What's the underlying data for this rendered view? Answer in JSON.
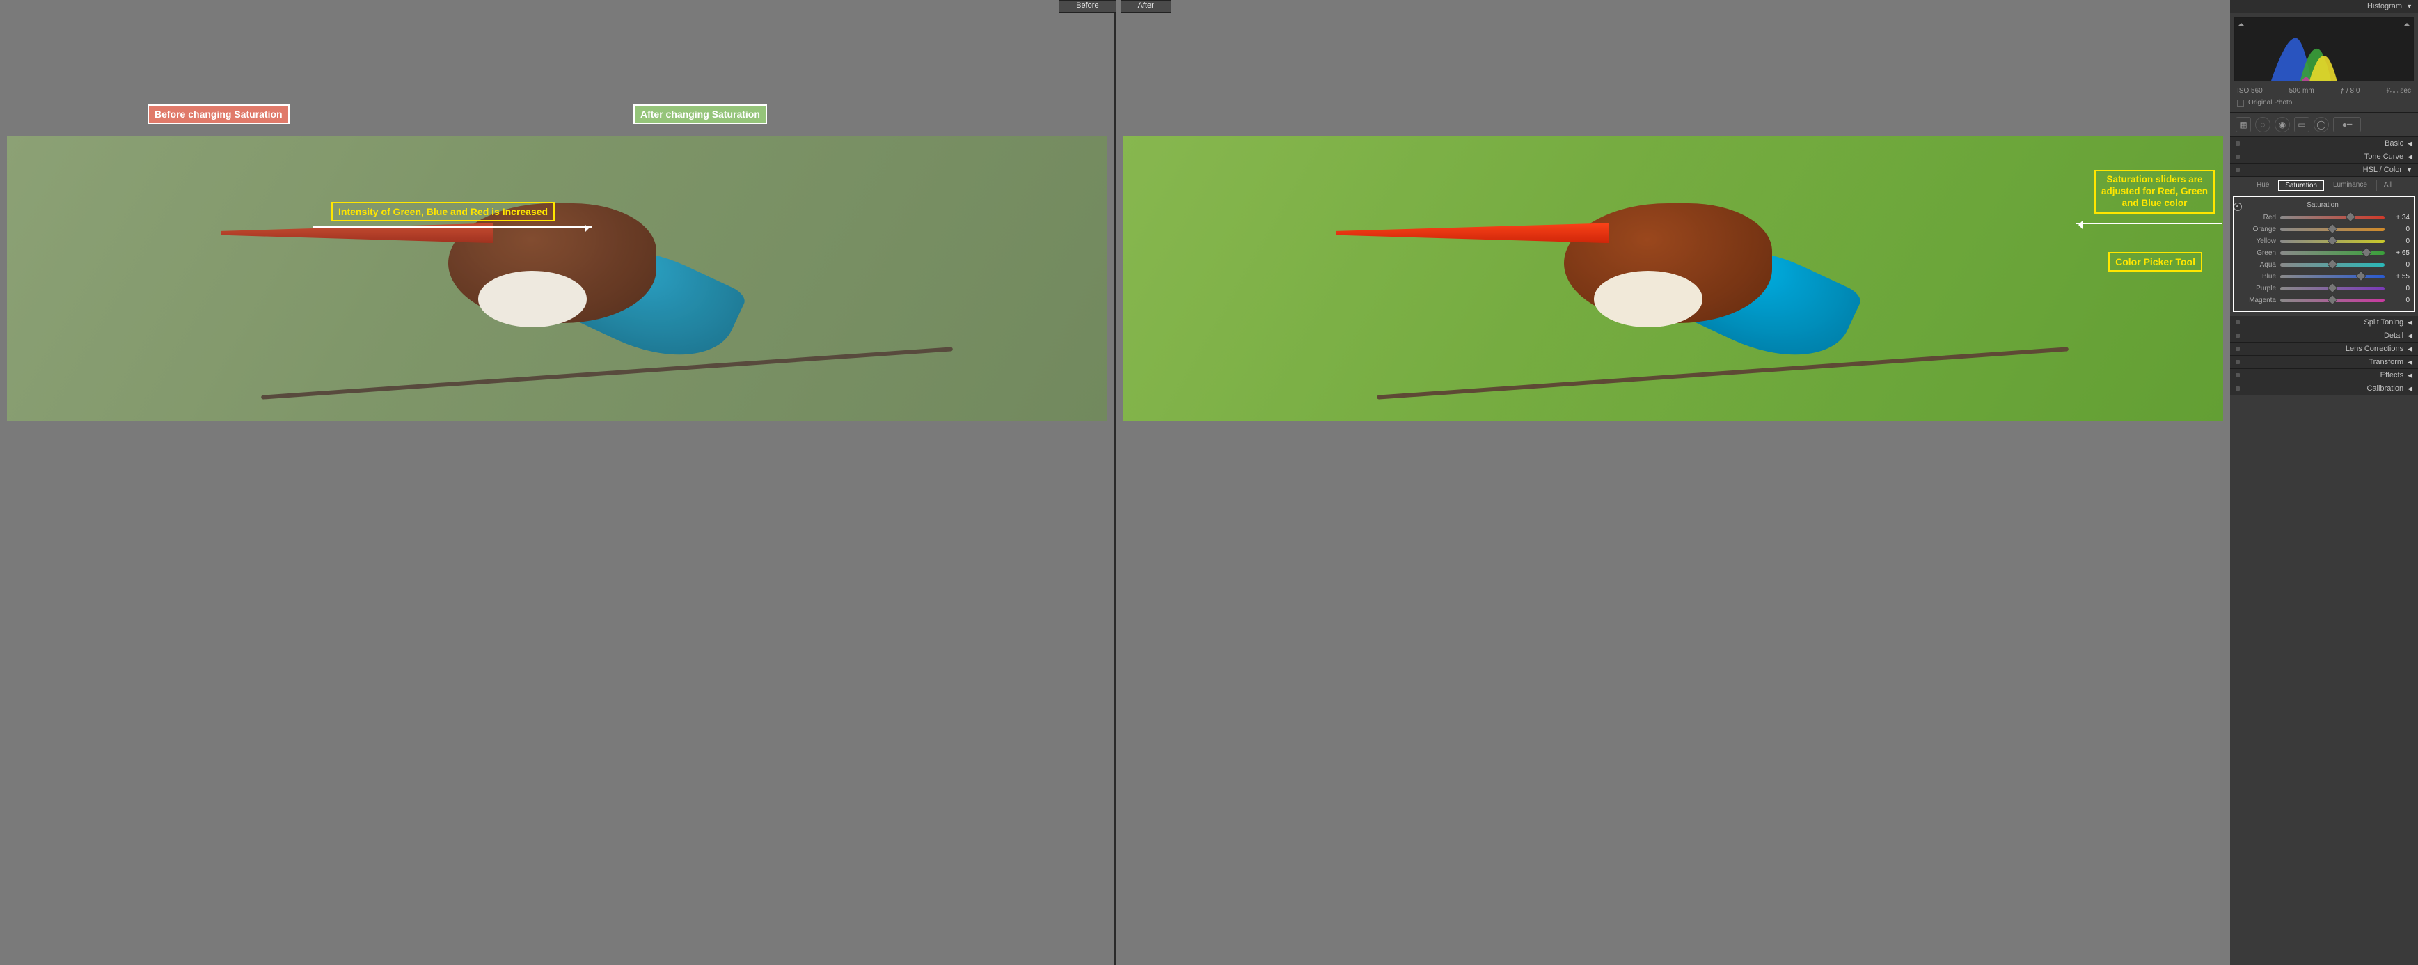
{
  "ba_labels": {
    "before": "Before",
    "after": "After"
  },
  "annotations": {
    "before_caption": "Before changing Saturation",
    "after_caption": "After changing Saturation",
    "intensity_note": "Intensity of Green, Blue and Red is Increased",
    "slider_note_l1": "Saturation sliders are",
    "slider_note_l2": "adjusted for Red, Green",
    "slider_note_l3": "and Blue color",
    "picker_note": "Color Picker Tool"
  },
  "panel": {
    "histogram": "Histogram",
    "meta": {
      "iso": "ISO 560",
      "focal": "500 mm",
      "aperture": "ƒ / 8.0",
      "shutter": "¹⁄₅₀₀ sec"
    },
    "original_photo": "Original Photo",
    "sections": {
      "basic": "Basic",
      "tone_curve": "Tone Curve",
      "hsl": "HSL / Color",
      "split_toning": "Split Toning",
      "detail": "Detail",
      "lens": "Lens Corrections",
      "transform": "Transform",
      "effects": "Effects",
      "calibration": "Calibration"
    },
    "hsl_tabs": {
      "hue": "Hue",
      "saturation": "Saturation",
      "luminance": "Luminance",
      "all": "All"
    },
    "hsl_title": "Saturation",
    "sliders": [
      {
        "name": "Red",
        "value": 34,
        "display": "+ 34",
        "grad": "linear-gradient(90deg,#8a8a8a,#d03a2a)"
      },
      {
        "name": "Orange",
        "value": 0,
        "display": "0",
        "grad": "linear-gradient(90deg,#8a8a8a,#d08a2a)"
      },
      {
        "name": "Yellow",
        "value": 0,
        "display": "0",
        "grad": "linear-gradient(90deg,#8a8a8a,#c8c82a)"
      },
      {
        "name": "Green",
        "value": 65,
        "display": "+ 65",
        "grad": "linear-gradient(90deg,#8a8a8a,#3aa03a)"
      },
      {
        "name": "Aqua",
        "value": 0,
        "display": "0",
        "grad": "linear-gradient(90deg,#8a8a8a,#2ab8b8)"
      },
      {
        "name": "Blue",
        "value": 55,
        "display": "+ 55",
        "grad": "linear-gradient(90deg,#8a8a8a,#2a5ad0)"
      },
      {
        "name": "Purple",
        "value": 0,
        "display": "0",
        "grad": "linear-gradient(90deg,#8a8a8a,#7a3ab8)"
      },
      {
        "name": "Magenta",
        "value": 0,
        "display": "0",
        "grad": "linear-gradient(90deg,#8a8a8a,#c83aa0)"
      }
    ]
  }
}
